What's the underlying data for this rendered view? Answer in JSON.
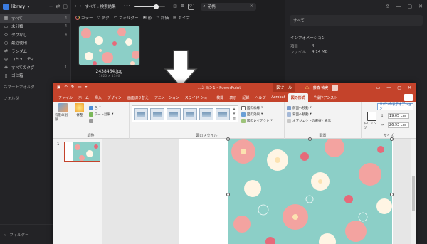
{
  "eagle": {
    "library_label": "library",
    "sidebar": {
      "items": [
        {
          "icon": "grid-icon",
          "glyph": "▦",
          "label": "すべて",
          "count": "4",
          "selected": true
        },
        {
          "icon": "folder-icon",
          "glyph": "▭",
          "label": "未分類",
          "count": "4",
          "selected": false
        },
        {
          "icon": "tag-icon",
          "glyph": "◇",
          "label": "タグなし",
          "count": "4",
          "selected": false
        },
        {
          "icon": "clock-icon",
          "glyph": "◷",
          "label": "最近使用",
          "count": "",
          "selected": false
        },
        {
          "icon": "shuffle-icon",
          "glyph": "⇄",
          "label": "ランダム",
          "count": "",
          "selected": false
        },
        {
          "icon": "community-icon",
          "glyph": "◎",
          "label": "コミュニティ",
          "count": "",
          "selected": false
        },
        {
          "icon": "tags-icon",
          "glyph": "◈",
          "label": "すべてのタグ",
          "count": "1",
          "selected": false
        },
        {
          "icon": "trash-icon",
          "glyph": "▯",
          "label": "ゴミ箱",
          "count": "",
          "selected": false
        }
      ],
      "section_smart": "スマートフォルダ",
      "section_folders": "フォルダ",
      "footer_filter": "フィルター"
    },
    "toolbar": {
      "breadcrumb": "すべて : 検索結果",
      "zoom_value": 0.7,
      "search_value": "花柄"
    },
    "filters": [
      "カラー",
      "タグ",
      "フォルダー",
      "形",
      "評価",
      "タイプ"
    ],
    "item": {
      "name": "2438464.jpg",
      "dimensions": "1620 × 1146"
    },
    "right": {
      "note": "すべて",
      "info_heading": "インフォメーション",
      "rows": [
        {
          "k": "項目",
          "v": "4"
        },
        {
          "k": "ファイル",
          "v": "4.14 MB"
        }
      ]
    }
  },
  "ppt": {
    "title": "...ション1 - PowerPoint",
    "context_tab": "図ツール",
    "user": "藤森 祐実",
    "tabs": [
      "ファイル",
      "ホーム",
      "挿入",
      "デザイン",
      "画面切り替え",
      "アニメーション",
      "スライド ショー",
      "校閲",
      "表示",
      "記録",
      "ヘルプ",
      "Acrobat",
      "図の形式"
    ],
    "active_tab": "図の形式",
    "tell_me": "操作アシスト",
    "ribbon": {
      "adjust_group": "調整",
      "remove_bg": "背景の削除",
      "corrections": "修整",
      "color": "色",
      "art": "アート効果",
      "styles_group": "図のスタイル",
      "border": "図の枠線",
      "effects": "図の効果",
      "layout": "図のレイアウト",
      "arrange_group": "配置",
      "forward": "前面へ移動",
      "backward": "背面へ移動",
      "selection": "オブジェクトの選択と表示",
      "size_group": "サイズ",
      "crop": "トリミング",
      "height": "19.05 cm",
      "width": "26.93 cm",
      "tip": "リボンの表示オプション"
    },
    "slide_number": "1"
  }
}
